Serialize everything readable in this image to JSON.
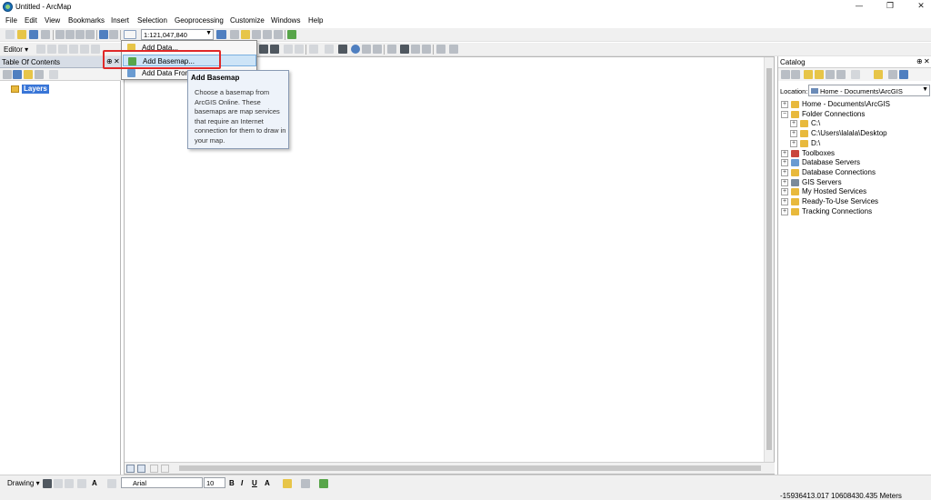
{
  "window": {
    "title": "Untitled - ArcMap",
    "min": "—",
    "max": "❐",
    "close": "✕"
  },
  "menu": [
    "File",
    "Edit",
    "View",
    "Bookmarks",
    "Insert",
    "Selection",
    "Geoprocessing",
    "Customize",
    "Windows",
    "Help"
  ],
  "toolbar": {
    "scale": "1:121,047,840",
    "editor_label": "Editor ▾"
  },
  "toc": {
    "title": "Table Of Contents",
    "layers_label": "Layers"
  },
  "add_data_menu": {
    "items": [
      "Add Data...",
      "Add Basemap...",
      "Add Data From"
    ],
    "highlighted": "Add Basemap..."
  },
  "tooltip": {
    "title": "Add Basemap",
    "body": "Choose a basemap from ArcGIS Online. These basemaps are map services that require an Internet connection for them to draw in your map."
  },
  "catalog": {
    "title": "Catalog",
    "location_label": "Location:",
    "location_value": "Home - Documents\\ArcGIS",
    "tree": [
      {
        "label": "Home - Documents\\ArcGIS",
        "level": 0,
        "expander": "+",
        "icon_color": "#e8b93c"
      },
      {
        "label": "Folder Connections",
        "level": 0,
        "expander": "−",
        "icon_color": "#e8b93c"
      },
      {
        "label": "C:\\",
        "level": 1,
        "expander": "+",
        "icon_color": "#e8b93c"
      },
      {
        "label": "C:\\Users\\lalala\\Desktop",
        "level": 1,
        "expander": "+",
        "icon_color": "#e8b93c"
      },
      {
        "label": "D:\\",
        "level": 1,
        "expander": "+",
        "icon_color": "#e8b93c"
      },
      {
        "label": "Toolboxes",
        "level": 0,
        "expander": "+",
        "icon_color": "#c9463d"
      },
      {
        "label": "Database Servers",
        "level": 0,
        "expander": "+",
        "icon_color": "#6a9bd1"
      },
      {
        "label": "Database Connections",
        "level": 0,
        "expander": "+",
        "icon_color": "#e8b93c"
      },
      {
        "label": "GIS Servers",
        "level": 0,
        "expander": "+",
        "icon_color": "#7a8a9a"
      },
      {
        "label": "My Hosted Services",
        "level": 0,
        "expander": "+",
        "icon_color": "#e8b93c"
      },
      {
        "label": "Ready-To-Use Services",
        "level": 0,
        "expander": "+",
        "icon_color": "#e8b93c"
      },
      {
        "label": "Tracking Connections",
        "level": 0,
        "expander": "+",
        "icon_color": "#e8b93c"
      }
    ]
  },
  "drawing": {
    "label": "Drawing ▾",
    "font": "Arial",
    "size": "10",
    "bold": "B",
    "italic": "I",
    "underline": "U",
    "font_color": "A"
  },
  "status": {
    "coordinates": "-15936413.017  10608430.435 Meters"
  }
}
